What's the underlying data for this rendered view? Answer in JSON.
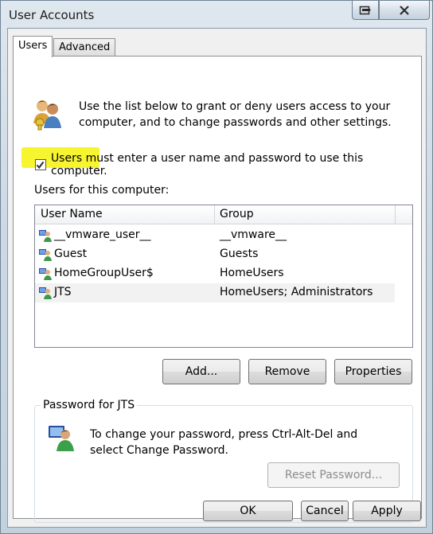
{
  "window": {
    "title": "User Accounts"
  },
  "tabs": [
    {
      "label": "Users",
      "active": true
    },
    {
      "label": "Advanced",
      "active": false
    }
  ],
  "intro": {
    "text": "Use the list below to grant or deny users access to your computer, and to change passwords and other settings."
  },
  "require_password": {
    "label": "Users must enter a user name and password to use this computer.",
    "checked": true
  },
  "users_list": {
    "label": "Users for this computer:",
    "columns": [
      "User Name",
      "Group"
    ],
    "rows": [
      {
        "name": "__vmware_user__",
        "group": "__vmware__"
      },
      {
        "name": "Guest",
        "group": "Guests"
      },
      {
        "name": "HomeGroupUser$",
        "group": "HomeUsers"
      },
      {
        "name": "JTS",
        "group": "HomeUsers; Administrators"
      }
    ],
    "selected_index": 3
  },
  "actions": {
    "add": "Add...",
    "remove": "Remove",
    "properties": "Properties"
  },
  "password_group": {
    "title": "Password for JTS",
    "text": "To change your password, press Ctrl-Alt-Del and select Change Password.",
    "reset_button": "Reset Password..."
  },
  "footer": {
    "ok": "OK",
    "cancel": "Cancel",
    "apply": "Apply"
  },
  "colors": {
    "highlight": "#f7f430",
    "selection": "#f2f2f2"
  },
  "icons": {
    "users": "users-icon",
    "user_row": "user-icon",
    "password": "password-user-icon",
    "restore": "restore-icon",
    "close": "close-icon",
    "checkmark": "checkmark-icon"
  }
}
